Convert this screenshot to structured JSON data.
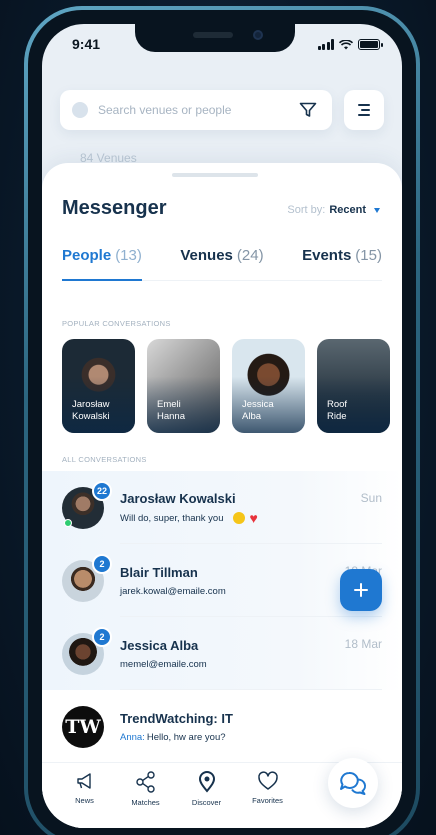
{
  "status": {
    "time": "9:41"
  },
  "search": {
    "placeholder": "Search venues or people"
  },
  "venues_count": "84 Venues",
  "messenger": {
    "title": "Messenger",
    "sort_label": "Sort by:",
    "sort_value": "Recent"
  },
  "tabs": [
    {
      "label": "People",
      "count": "(13)"
    },
    {
      "label": "Venues",
      "count": "(24)"
    },
    {
      "label": "Events",
      "count": "(15)"
    }
  ],
  "popular_label": "POPULAR CONVERSATIONS",
  "popular": [
    {
      "name": "Jarosław\nKowalski"
    },
    {
      "name": "Emeli\nHanna"
    },
    {
      "name": "Jessica\nAlba"
    },
    {
      "name": "Roof\nRide"
    }
  ],
  "all_label": "ALL CONVERSATIONS",
  "conversations": [
    {
      "name": "Jarosław Kowalski",
      "message": "Will do, super, thank you",
      "date": "Sun",
      "badge": "22"
    },
    {
      "name": "Blair Tillman",
      "message": "jarek.kowal@emaile.com",
      "date": "18 Mar",
      "badge": "2"
    },
    {
      "name": "Jessica Alba",
      "message": "memel@emaile.com",
      "date": "18 Mar",
      "badge": "2"
    },
    {
      "name": "TrendWatching: IT",
      "sender": "Anna:",
      "message": "Hello, hw are you?",
      "avatar_text": "TW"
    }
  ],
  "tabbar": [
    {
      "label": "News",
      "icon": "megaphone-icon"
    },
    {
      "label": "Matches",
      "icon": "share-nodes-icon"
    },
    {
      "label": "Discover",
      "icon": "map-pin-icon"
    },
    {
      "label": "Favorites",
      "icon": "heart-icon"
    }
  ],
  "colors": {
    "accent": "#1f78d1",
    "title": "#17324d",
    "online": "#2ecc71"
  }
}
